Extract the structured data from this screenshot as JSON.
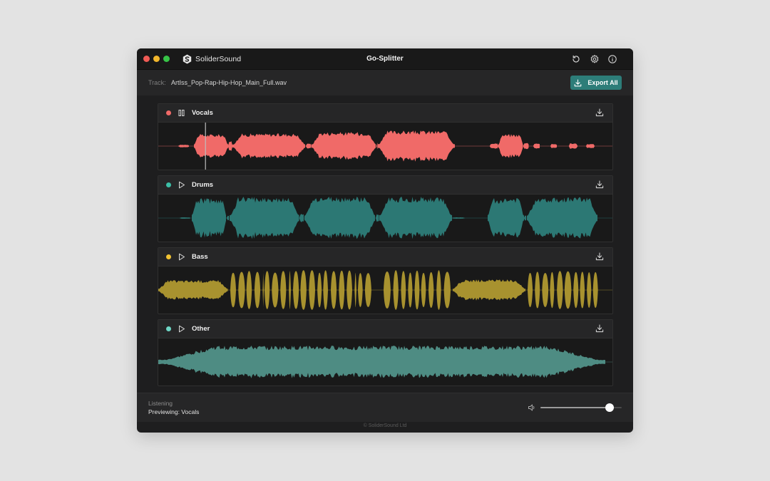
{
  "window": {
    "brand_name": "SoliderSound",
    "title": "Go-Splitter"
  },
  "toolbar_icons": [
    "undo-icon",
    "gear-icon",
    "info-icon"
  ],
  "track": {
    "label": "Track:",
    "filename": "ArtIss_Pop-Rap-Hip-Hop_Main_Full.wav"
  },
  "export_button": {
    "label": "Export All",
    "icon": "download-icon"
  },
  "stems": [
    {
      "name": "Vocals",
      "color": "#f06a68",
      "state": "pause",
      "icon": "pause-icon",
      "download_icon": "download-icon"
    },
    {
      "name": "Drums",
      "color": "#2c7874",
      "state": "play",
      "icon": "play-icon",
      "download_icon": "download-icon"
    },
    {
      "name": "Bass",
      "color": "#a8922f",
      "state": "play",
      "icon": "play-icon",
      "download_icon": "download-icon"
    },
    {
      "name": "Other",
      "color": "#4e8c83",
      "state": "play",
      "icon": "play-icon",
      "download_icon": "download-icon"
    }
  ],
  "dot_colors": [
    "#f06a68",
    "#3cbfa7",
    "#f1c232",
    "#6ed7c6"
  ],
  "playhead_fraction": 0.104,
  "status": {
    "label": "Listening",
    "value": "Previewing: Vocals"
  },
  "volume": {
    "icon": "speaker-icon",
    "level": 0.85
  },
  "footer": {
    "copyright": "© SoliderSound Ltd"
  },
  "colors": {
    "accent": "#2d7d79"
  }
}
